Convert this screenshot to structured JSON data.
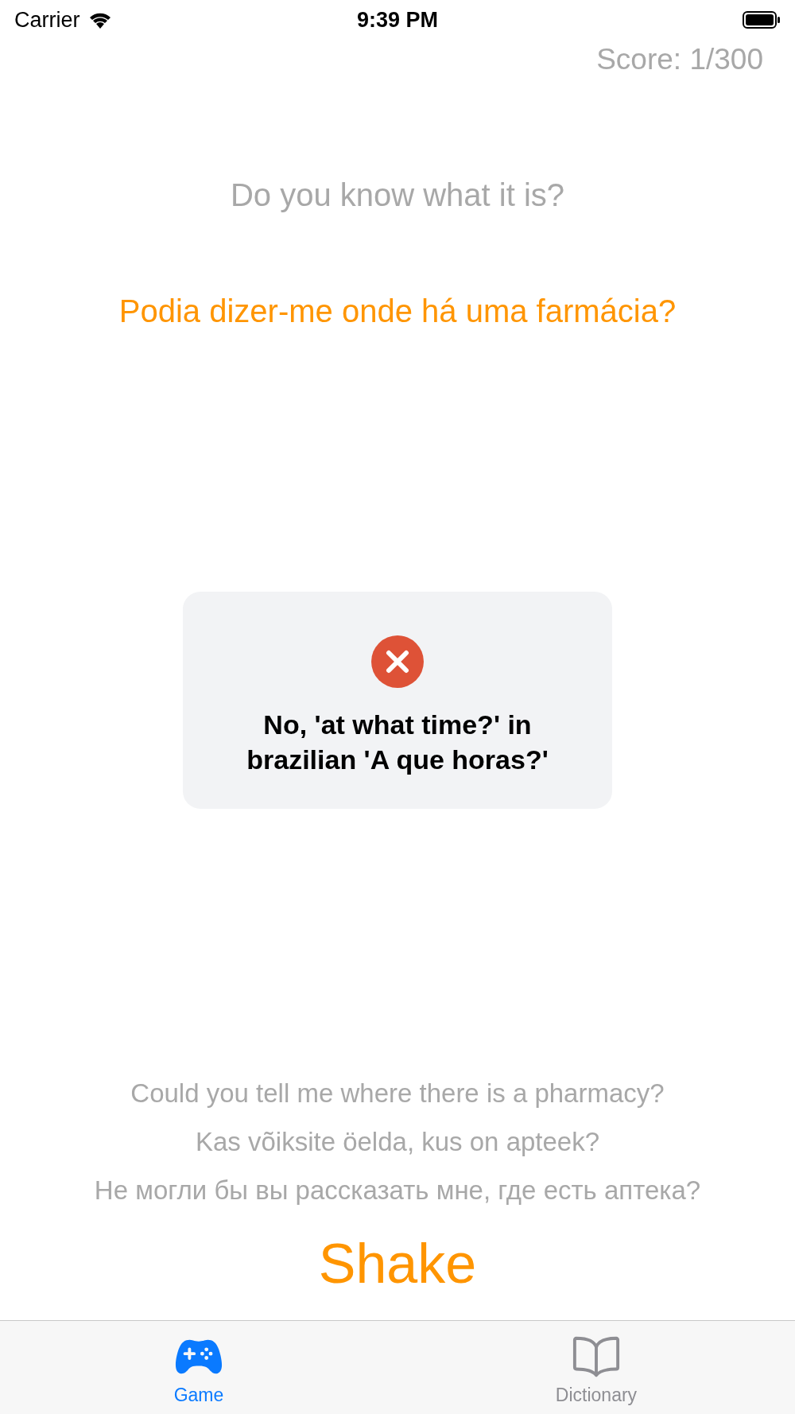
{
  "status_bar": {
    "carrier": "Carrier",
    "time": "9:39 PM"
  },
  "score": "Score: 1/300",
  "prompt": "Do you know what it is?",
  "phrase": "Podia dizer-me onde há uma farmácia?",
  "toast": {
    "kind": "error",
    "message": "No, 'at what time?' in brazilian 'A que horas?'"
  },
  "translations": [
    "Could you tell me where there is a pharmacy?",
    "Kas võiksite öelda, kus on apteek?",
    "Не могли бы вы рассказать мне, где есть аптека?"
  ],
  "shake_button": "Shake",
  "tabs": [
    {
      "label": "Game",
      "kind": "game",
      "selected": true
    },
    {
      "label": "Dictionary",
      "kind": "dictionary",
      "selected": false
    }
  ]
}
